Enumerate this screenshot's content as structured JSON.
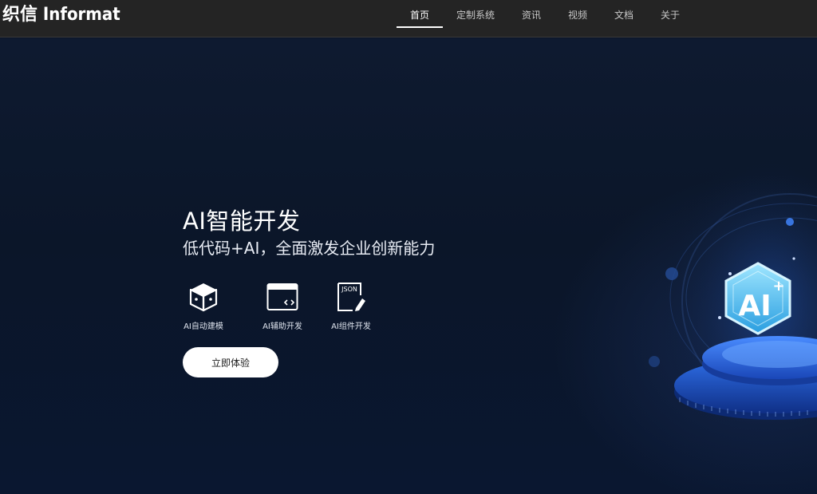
{
  "header": {
    "logo_text": "织信 Informat",
    "nav": [
      {
        "label": "首页",
        "active": true
      },
      {
        "label": "定制系统",
        "active": false
      },
      {
        "label": "资讯",
        "active": false
      },
      {
        "label": "视频",
        "active": false
      },
      {
        "label": "文档",
        "active": false
      },
      {
        "label": "关于",
        "active": false
      }
    ]
  },
  "hero": {
    "title": "AI智能开发",
    "subtitle": "低代码+AI，全面激发企业创新能力",
    "features": [
      {
        "label": "AI自动建模",
        "icon": "cube-icon"
      },
      {
        "label": "AI辅助开发",
        "icon": "code-window-icon"
      },
      {
        "label": "AI组件开发",
        "icon": "json-document-icon"
      }
    ],
    "cta_label": "立即体验",
    "illustration": {
      "badge_text": "AI",
      "badge_plus": "+"
    }
  },
  "colors": {
    "header_bg": "#242424",
    "hero_bg": "#0b1629",
    "accent_blue": "#2f6fe8",
    "button_bg": "#ffffff"
  }
}
